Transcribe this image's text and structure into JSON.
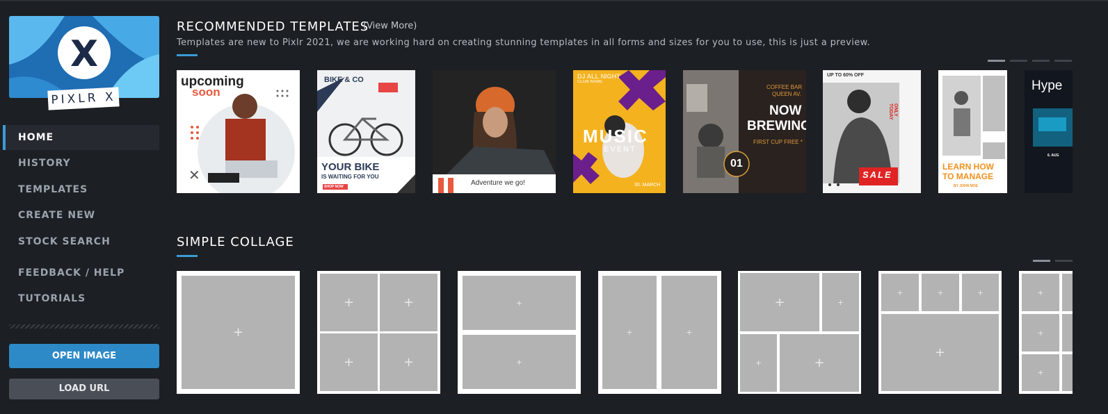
{
  "sidebar": {
    "logo_text": "PIXLR X",
    "logo_letter": "X",
    "nav": [
      {
        "label": "HOME",
        "active": true
      },
      {
        "label": "HISTORY"
      },
      {
        "label": "TEMPLATES"
      },
      {
        "label": "CREATE NEW"
      },
      {
        "label": "STOCK SEARCH"
      },
      {
        "label": "FEEDBACK / HELP"
      },
      {
        "label": "TUTORIALS"
      }
    ],
    "open_image": "OPEN IMAGE",
    "load_url": "LOAD URL"
  },
  "recommended": {
    "title": "RECOMMENDED TEMPLATES",
    "view_more": "(View More)",
    "subtitle": "Templates are new to Pixlr 2021, we are working hard on creating stunning templates in all forms and sizes for you to use, this is just a preview.",
    "templates": [
      {
        "line1": "upcoming",
        "line2": "soon"
      },
      {
        "brand": "BIKE & CO",
        "line1": "YOUR BIKE",
        "line2": "IS WAITING FOR YOU",
        "cta": "SHOP NOW"
      },
      {
        "caption": "Adventure we go!"
      },
      {
        "top": "DJ ALL NIGHT",
        "club": "CLUB NAME",
        "line1": "MUSIC",
        "line2": "EVENT",
        "date": "30. MARCH"
      },
      {
        "top": "COFFEE BAR",
        "top2": "QUEEN AV.",
        "line1": "NOW",
        "line2": "BREWING",
        "sub": "FIRST CUP FREE *",
        "num": "01"
      },
      {
        "top": "UP TO 60% OFF",
        "side": "ONLY TODAY",
        "sale": "SALE"
      },
      {
        "line1": "LEARN HOW",
        "line2": "TO MANAGE",
        "by": "BY JOHN MOE"
      },
      {
        "line1": "Hype",
        "date": "6. AUG"
      }
    ],
    "pager": [
      true,
      false,
      false,
      false
    ]
  },
  "collage": {
    "title": "SIMPLE COLLAGE",
    "plus": "+",
    "pager": [
      true,
      false
    ]
  },
  "colors": {
    "accent": "#3b9bd6",
    "background": "#1c1f23",
    "open_button": "#2d8ac7"
  }
}
